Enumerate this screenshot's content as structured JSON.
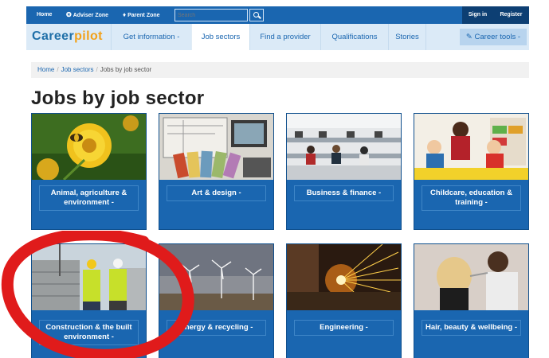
{
  "topbar": {
    "home": "Home",
    "adviser_zone": "Adviser Zone",
    "parent_zone": "Parent Zone",
    "search_placeholder": "Search",
    "sign_in": "Sign in",
    "register": "Register"
  },
  "brand": {
    "part1": "Career",
    "part2": "pilot"
  },
  "nav": {
    "items": [
      {
        "label": "Get information -"
      },
      {
        "label": "Job sectors"
      },
      {
        "label": "Find a provider"
      },
      {
        "label": "Qualifications"
      },
      {
        "label": "Stories"
      }
    ],
    "active": "Job sectors",
    "career_tools": "Career tools -"
  },
  "breadcrumb": {
    "home": "Home",
    "sectors": "Job sectors",
    "current": "Jobs by job sector",
    "separator": "/"
  },
  "page": {
    "title": "Jobs by job sector"
  },
  "sectors": [
    {
      "label": "Animal, agriculture & environment -"
    },
    {
      "label": "Art & design -"
    },
    {
      "label": "Business & finance -"
    },
    {
      "label": "Childcare, education & training -"
    },
    {
      "label": "Construction & the built environment -"
    },
    {
      "label": "Energy & recycling -"
    },
    {
      "label": "Engineering -"
    },
    {
      "label": "Hair, beauty & wellbeing -"
    }
  ],
  "icons": {
    "adviser": "adviser-zone-icon",
    "parent": "parent-zone-icon",
    "search": "search-icon",
    "tools": "pencil-icon"
  },
  "colors": {
    "primary": "#1a66b0",
    "dark": "#0d3f73",
    "nav_bg": "#dbeaf7",
    "brand_blue": "#1f6fa8",
    "brand_orange": "#f2a11a",
    "annotation": "#e01b1b"
  }
}
